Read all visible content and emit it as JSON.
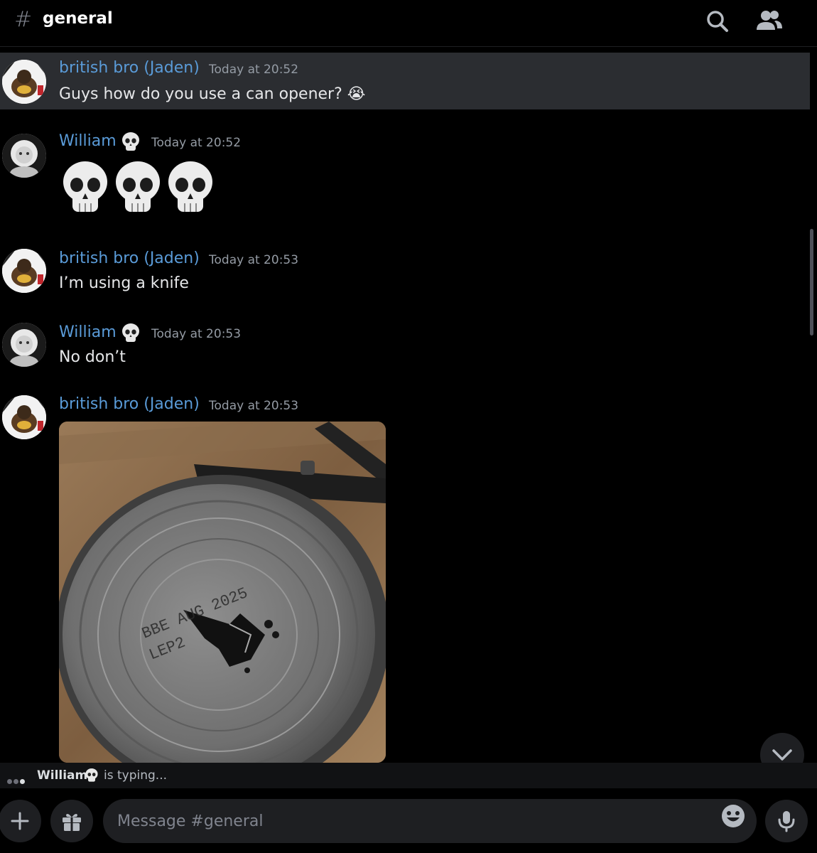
{
  "header": {
    "hash_symbol": "#",
    "channel": "general",
    "icons": [
      "search-icon",
      "members-icon"
    ]
  },
  "messages": [
    {
      "author": "british bro (Jaden)",
      "time": "Today at 20:52",
      "text": "Guys how do you use a can opener? 😭",
      "highlighted": true
    },
    {
      "author": "William",
      "time": "Today at 20:52",
      "text": "💀💀💀",
      "badge": "skull-emoji"
    },
    {
      "author": "british bro (Jaden)",
      "time": "Today at 20:53",
      "text": "I’m using a knife"
    },
    {
      "author": "William",
      "time": "Today at 20:53",
      "text": "No don’t",
      "badge": "skull-emoji"
    },
    {
      "author": "british bro (Jaden)",
      "time": "Today at 20:53",
      "attachment": "image"
    }
  ],
  "typing": {
    "name": "William",
    "text": "is typing..."
  },
  "composer": {
    "placeholder": "Message #general"
  },
  "colors": {
    "background": "#000000",
    "author": "#5a9bd8",
    "timestamp": "#949ba4",
    "highlight": "#2b2d31",
    "surface": "#1e1f22"
  }
}
